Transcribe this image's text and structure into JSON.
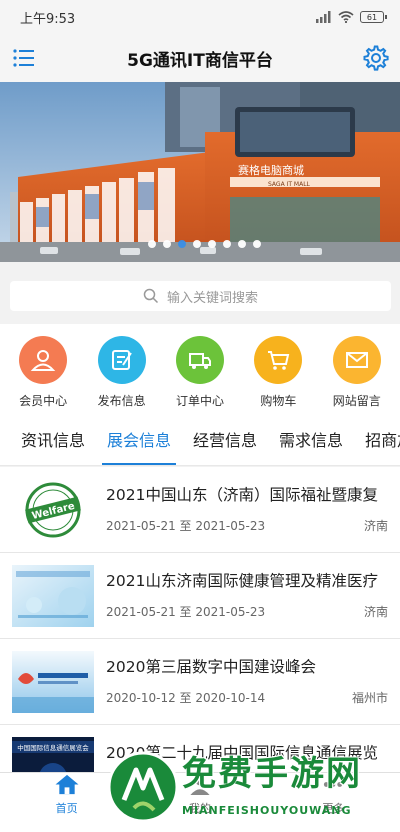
{
  "status": {
    "time": "上午9:53",
    "battery": "61"
  },
  "header": {
    "title": "5G通讯IT商信平台"
  },
  "banner": {
    "sign_cn": "赛格电脑商城",
    "sign_en": "SAGA IT MALL",
    "dots": 8,
    "active_dot": 2
  },
  "search": {
    "placeholder": "输入关键词搜索"
  },
  "quick": [
    {
      "label": "会员中心",
      "color": "#f47b52",
      "icon": "user-icon"
    },
    {
      "label": "发布信息",
      "color": "#2eb6e6",
      "icon": "edit-icon"
    },
    {
      "label": "订单中心",
      "color": "#6cc33a",
      "icon": "truck-icon"
    },
    {
      "label": "购物车",
      "color": "#f7b21d",
      "icon": "cart-icon"
    },
    {
      "label": "网站留言",
      "color": "#fbb530",
      "icon": "mail-icon"
    }
  ],
  "tabs": [
    {
      "label": "资讯信息"
    },
    {
      "label": "展会信息"
    },
    {
      "label": "经营信息"
    },
    {
      "label": "需求信息"
    },
    {
      "label": "招商加"
    }
  ],
  "active_tab": 1,
  "items": [
    {
      "title": "2021中国山东（济南）国际福祉暨康复",
      "dates": "2021-05-21 至 2021-05-23",
      "city": "济南"
    },
    {
      "title": "2021山东济南国际健康管理及精准医疗",
      "dates": "2021-05-21 至 2021-05-23",
      "city": "济南"
    },
    {
      "title": "2020第三届数字中国建设峰会",
      "dates": "2020-10-12 至 2020-10-14",
      "city": "福州市"
    },
    {
      "title": "2020第二十九届中国国际信息通信展览",
      "dates": "",
      "city": ""
    }
  ],
  "thumbs": {
    "welfare": "Welfare",
    "slide4": "中国国际信息通信展览会"
  },
  "nav": [
    {
      "label": "首页"
    },
    {
      "label": "我的"
    },
    {
      "label": "更多"
    }
  ],
  "watermark": {
    "text": "免费手游网",
    "sub": "MIANFEISHOUYOUWANG"
  },
  "colors": {
    "accent": "#1d80d8"
  }
}
